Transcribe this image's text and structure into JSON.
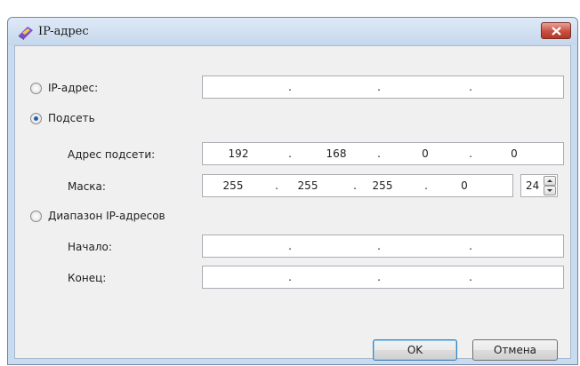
{
  "window": {
    "title": "IP-адрес",
    "close_glyph": "×"
  },
  "options": {
    "ip_address": {
      "label": "IP-адрес:",
      "checked": false,
      "octets": [
        "",
        "",
        "",
        ""
      ]
    },
    "subnet": {
      "label": "Подсеть",
      "checked": true,
      "address_label": "Адрес подсети:",
      "address_octets": [
        "192",
        "168",
        "0",
        "0"
      ],
      "mask_label": "Маска:",
      "mask_octets": [
        "255",
        "255",
        "255",
        "0"
      ],
      "prefix": "24"
    },
    "range": {
      "label": "Диапазон IP-адресов",
      "checked": false,
      "start_label": "Начало:",
      "start_octets": [
        "",
        "",
        "",
        ""
      ],
      "end_label": "Конец:",
      "end_octets": [
        "",
        "",
        "",
        ""
      ]
    }
  },
  "separator": ".",
  "buttons": {
    "ok": "OK",
    "cancel": "Отмена"
  },
  "icons": {
    "app": "ip-network-icon",
    "close": "close-icon"
  },
  "colors": {
    "titlebar": "#c9dbef",
    "close": "#c75042",
    "radio_checked": "#1f5fb6"
  }
}
